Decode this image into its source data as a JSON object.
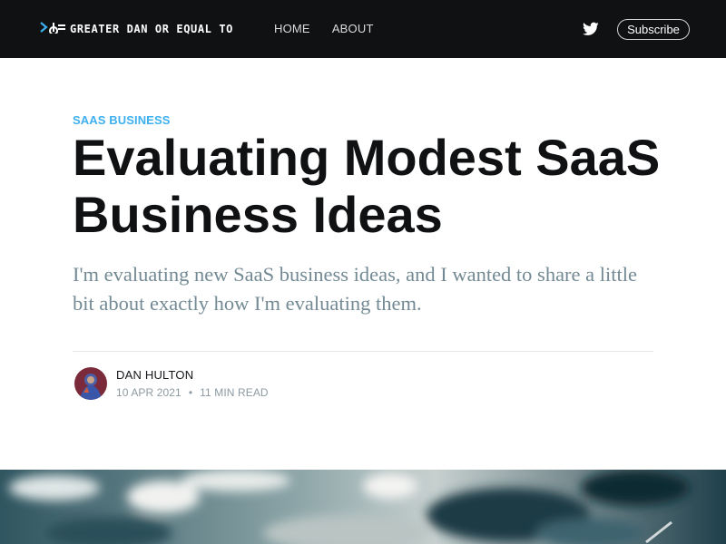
{
  "header": {
    "logo_text": "GREATER DAN OR EQUAL TO",
    "nav": [
      "HOME",
      "ABOUT"
    ],
    "subscribe_label": "Subscribe"
  },
  "article": {
    "tag": "SAAS BUSINESS",
    "title": "Evaluating Modest SaaS Business Ideas",
    "excerpt": "I'm evaluating new SaaS business ideas, and I wanted to share a little bit about exactly how I'm evaluating them.",
    "author": "DAN HULTON",
    "date": "10 APR 2021",
    "bullet": "•",
    "reading_time": "11 MIN READ"
  },
  "icons": {
    "social": "twitter-icon",
    "logo": "greater-or-equal-logo-icon"
  },
  "colors": {
    "header_bg": "#0f1113",
    "tag": "#3eb0ef",
    "excerpt": "#738a94",
    "meta": "#8e9aa1"
  }
}
